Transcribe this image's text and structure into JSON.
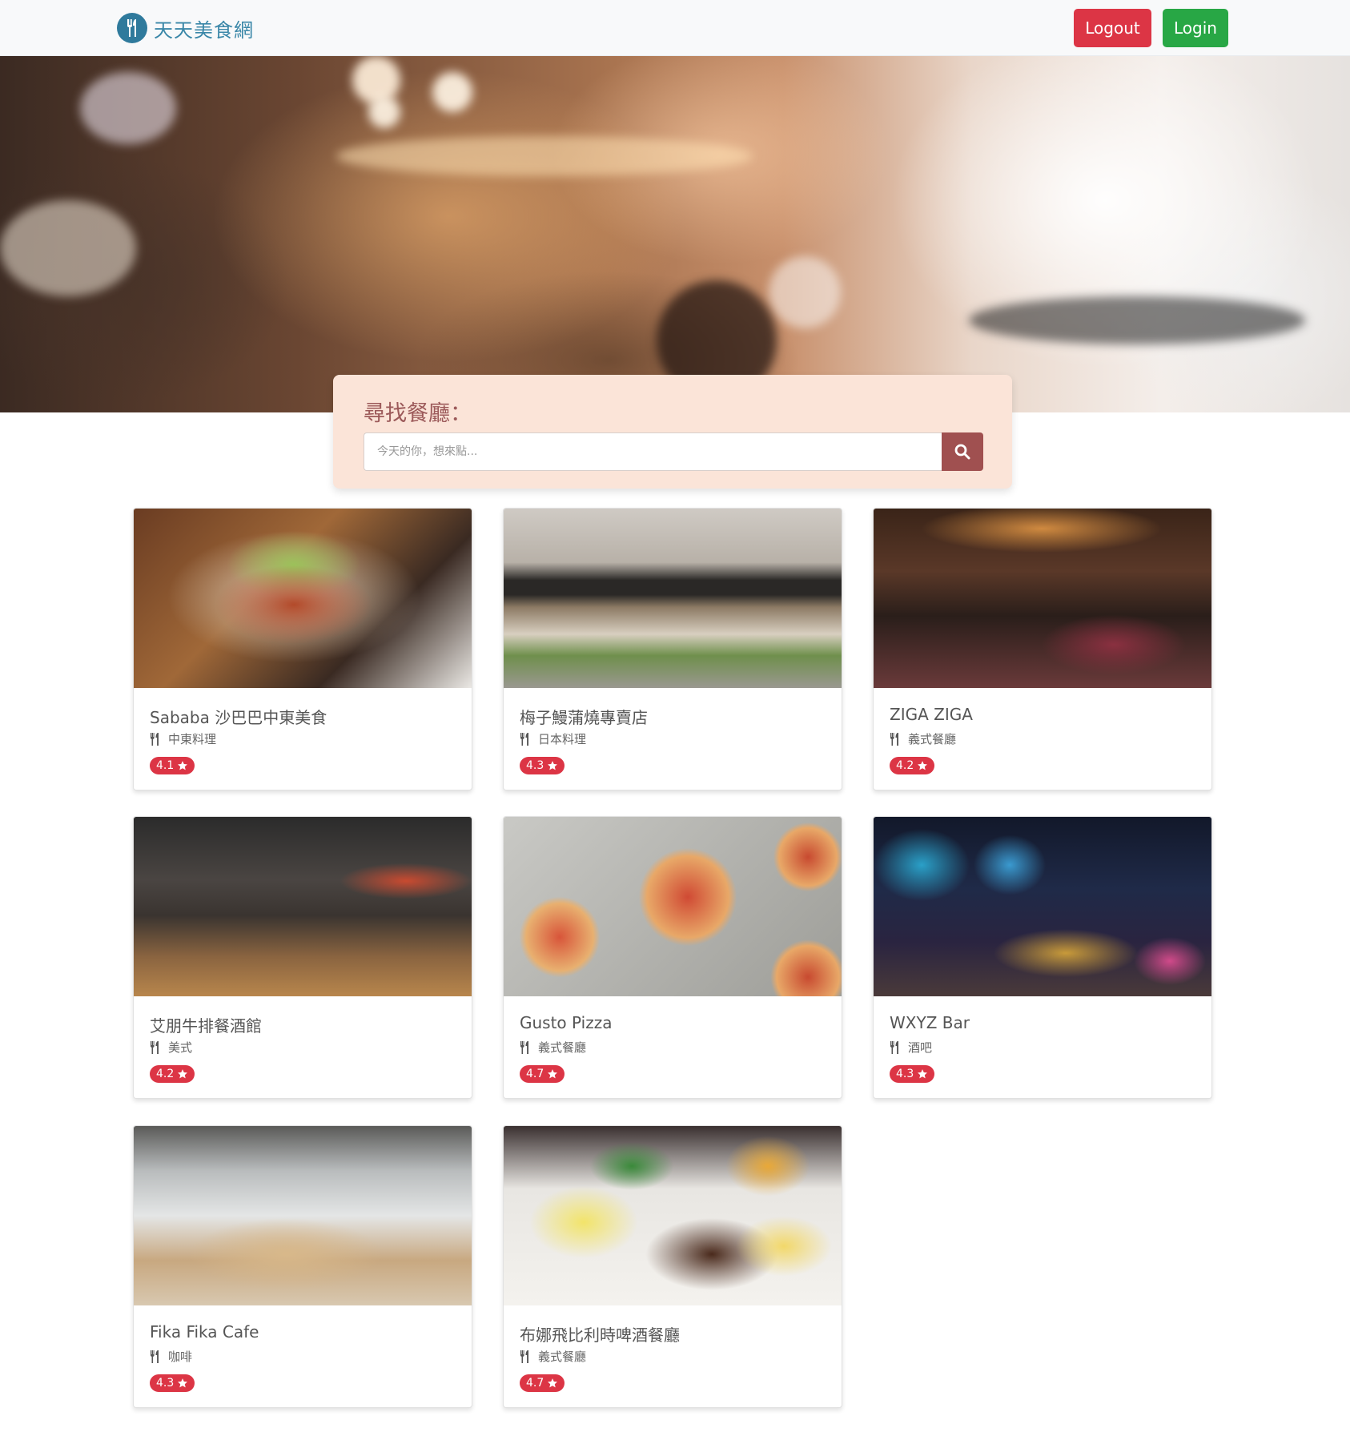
{
  "brand": {
    "name": "天天美食網",
    "icon": "utensils-icon"
  },
  "nav": {
    "logout_label": "Logout",
    "login_label": "Login"
  },
  "search": {
    "title": "尋找餐廳：",
    "placeholder": "今天的你，想來點...",
    "button_icon": "search-icon"
  },
  "colors": {
    "accent": "#a05050",
    "danger": "#dc3545",
    "success": "#28a745",
    "panel": "#fbe4d8"
  },
  "restaurants": [
    {
      "name": "Sababa 沙巴巴中東美食",
      "category": "中東料理",
      "rating": "4.1"
    },
    {
      "name": "梅子鰻蒲燒專賣店",
      "category": "日本料理",
      "rating": "4.3"
    },
    {
      "name": "ZIGA ZIGA",
      "category": "義式餐廳",
      "rating": "4.2"
    },
    {
      "name": "艾朋牛排餐酒館",
      "category": "美式",
      "rating": "4.2"
    },
    {
      "name": "Gusto Pizza",
      "category": "義式餐廳",
      "rating": "4.7"
    },
    {
      "name": "WXYZ Bar",
      "category": "酒吧",
      "rating": "4.3"
    },
    {
      "name": "Fika Fika Cafe",
      "category": "咖啡",
      "rating": "4.3"
    },
    {
      "name": "布娜飛比利時啤酒餐廳",
      "category": "義式餐廳",
      "rating": "4.7"
    }
  ]
}
